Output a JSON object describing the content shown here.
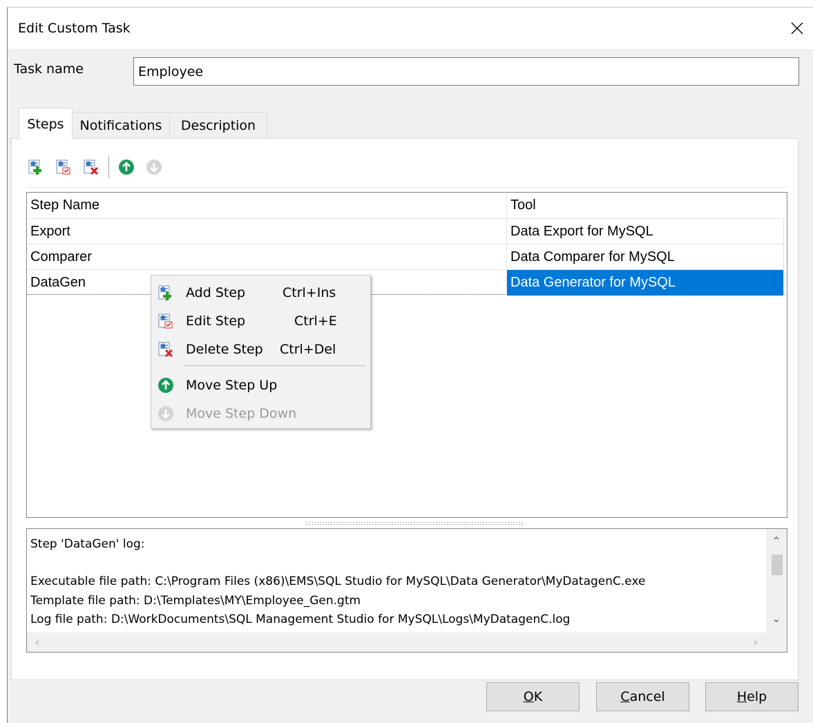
{
  "window": {
    "title": "Edit Custom Task"
  },
  "task": {
    "label": "Task name",
    "value": "Employee"
  },
  "tabs": [
    {
      "label": "Steps",
      "active": true
    },
    {
      "label": "Notifications",
      "active": false
    },
    {
      "label": "Description",
      "active": false
    }
  ],
  "toolbar": {
    "buttons": [
      "add-step-icon",
      "edit-step-icon",
      "delete-step-icon",
      "move-up-icon",
      "move-down-icon"
    ]
  },
  "grid": {
    "columns": [
      "Step Name",
      "Tool"
    ],
    "rows": [
      {
        "name": "Export",
        "tool": "Data Export for MySQL"
      },
      {
        "name": "Comparer",
        "tool": "Data Comparer for MySQL"
      },
      {
        "name": "DataGen",
        "tool": "Data Generator for MySQL",
        "selected": true
      }
    ]
  },
  "context_menu": {
    "items": [
      {
        "label": "Add Step",
        "shortcut": "Ctrl+Ins",
        "icon": "add-step-icon",
        "enabled": true
      },
      {
        "label": "Edit Step",
        "shortcut": "Ctrl+E",
        "icon": "edit-step-icon",
        "enabled": true
      },
      {
        "label": "Delete Step",
        "shortcut": "Ctrl+Del",
        "icon": "delete-step-icon",
        "enabled": true
      },
      {
        "label": "Move Step Up",
        "shortcut": "",
        "icon": "move-up-icon",
        "enabled": true
      },
      {
        "label": "Move Step Down",
        "shortcut": "",
        "icon": "move-down-icon",
        "enabled": false
      }
    ]
  },
  "log": {
    "lines": [
      "Step 'DataGen' log:",
      "",
      "Executable file path: C:\\Program Files (x86)\\EMS\\SQL Studio for MySQL\\Data Generator\\MyDatagenC.exe",
      "Template file path: D:\\Templates\\MY\\Employee_Gen.gtm",
      "Log file path: D:\\WorkDocuments\\SQL Management Studio for MySQL\\Logs\\MyDatagenC.log"
    ]
  },
  "buttons": {
    "ok": {
      "label": "OK",
      "mnemonic": "O",
      "rest": "K"
    },
    "cancel": {
      "label": "Cancel",
      "mnemonic": "C",
      "rest": "ancel"
    },
    "help": {
      "label": "Help",
      "mnemonic": "H",
      "rest": "elp"
    }
  },
  "colors": {
    "selection": "#0078d7",
    "up_green": "#1a9a5a",
    "disabled_gray": "#c8c8c8"
  }
}
